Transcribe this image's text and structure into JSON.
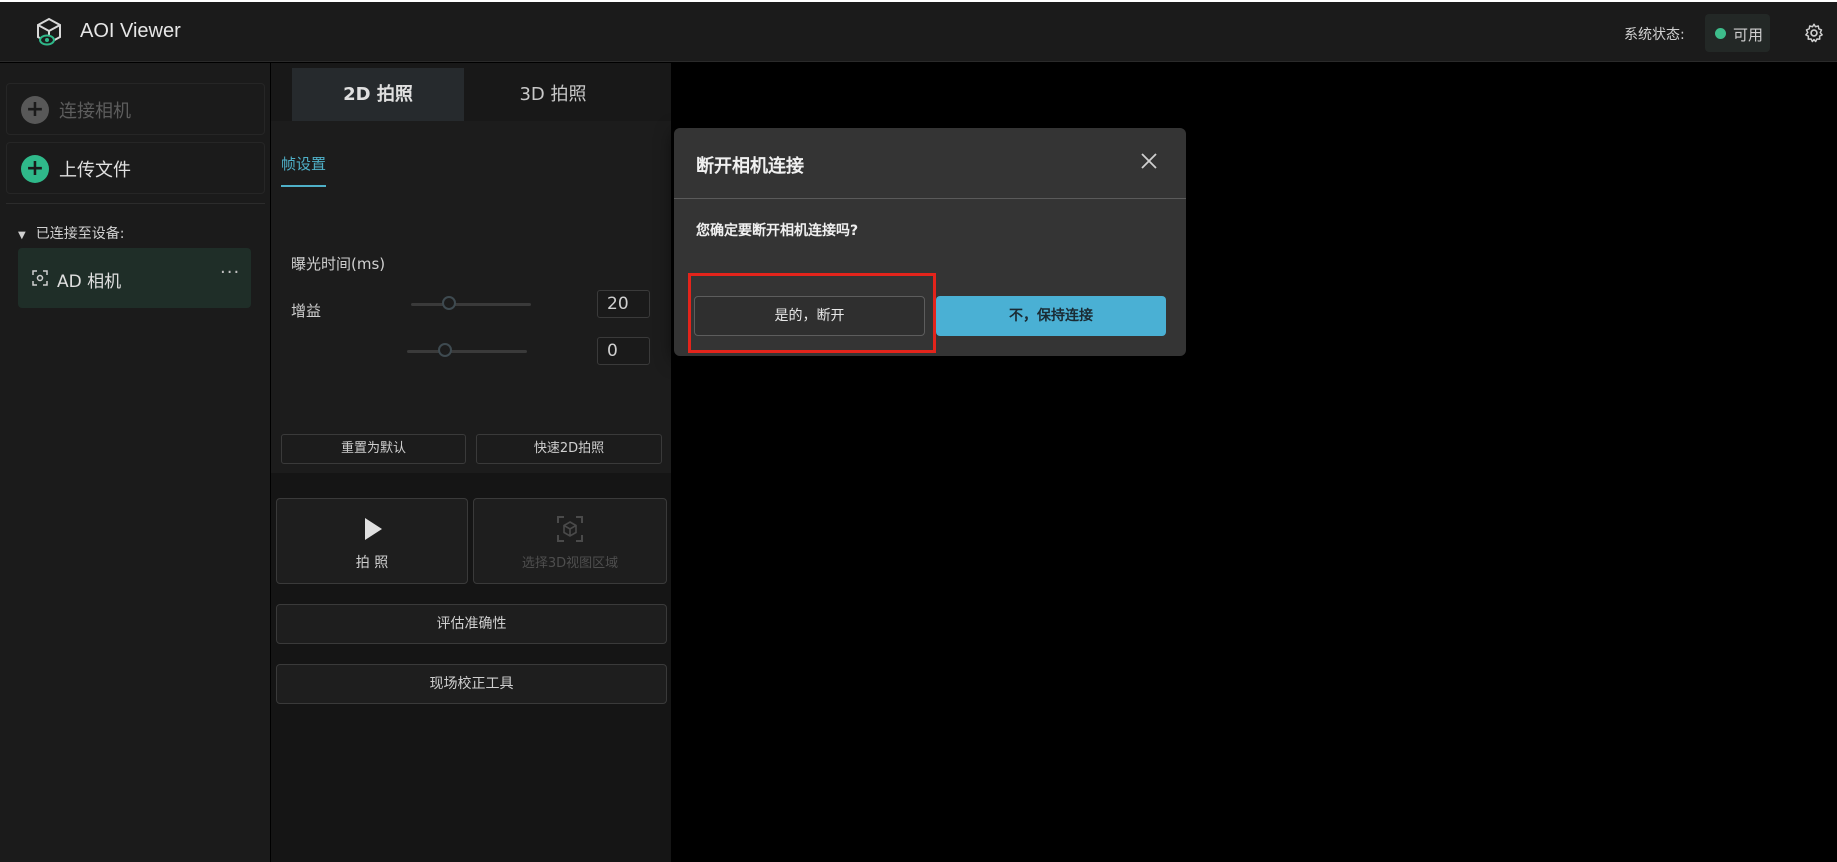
{
  "app": {
    "title": "AOI Viewer"
  },
  "header": {
    "status_label": "系统状态:",
    "status_value": "可用",
    "status_color": "#3dbd8b"
  },
  "sidebar": {
    "connect_camera": "连接相机",
    "upload_file": "上传文件",
    "connected_heading": "已连接至设备:",
    "device_name": "AD 相机",
    "device_menu": "···"
  },
  "panel": {
    "tabs": [
      "2D 拍照",
      "3D 拍照"
    ],
    "subtab": "帧设置",
    "exposure_label": "曝光时间(ms)",
    "exposure_value": "20",
    "gain_label": "增益",
    "gain_value": "0",
    "reset_default": "重置为默认",
    "quick_capture": "快速2D拍照",
    "capture": "拍 照",
    "select_3d_region": "选择3D视图区域",
    "evaluate_accuracy": "评估准确性",
    "field_calibration": "现场校正工具"
  },
  "dialog": {
    "title": "断开相机连接",
    "message": "您确定要断开相机连接吗?",
    "confirm": "是的，断开",
    "cancel": "不，保持连接"
  },
  "colors": {
    "accent": "#4ab0d4",
    "green": "#2fb98a",
    "highlight": "#e3241b"
  }
}
